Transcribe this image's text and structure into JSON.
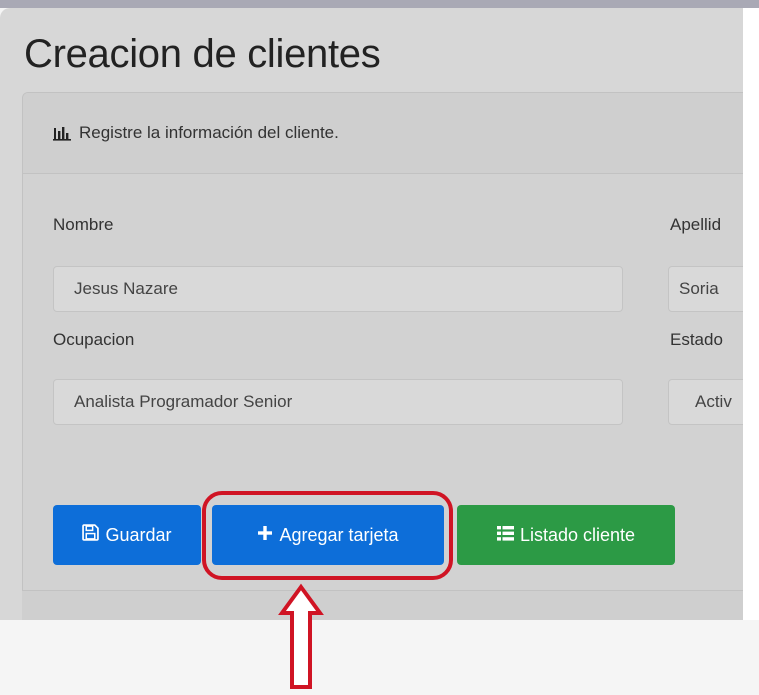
{
  "page": {
    "title": "Creacion de clientes"
  },
  "card": {
    "header_icon": "bar-chart-icon",
    "header_text": "Registre la información del cliente."
  },
  "form": {
    "nombre_label": "Nombre",
    "nombre_value": "Jesus Nazare",
    "apellido_label": "Apellid",
    "apellido_value": "Soria",
    "ocupacion_label": "Ocupacion",
    "ocupacion_value": "Analista Programador Senior",
    "estado_label": "Estado",
    "estado_value": "Activ"
  },
  "buttons": {
    "guardar_label": "Guardar",
    "guardar_icon": "save-icon",
    "agregar_label": "Agregar tarjeta",
    "agregar_icon": "plus-icon",
    "listado_label": "Listado cliente",
    "listado_icon": "list-icon"
  },
  "colors": {
    "primary": "#0d6ed9",
    "success": "#2c9a45",
    "highlight": "#d01424"
  }
}
